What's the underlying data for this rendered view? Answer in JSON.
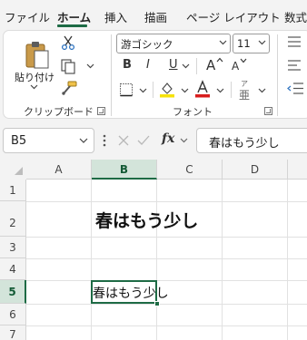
{
  "menu": {
    "tabs": [
      {
        "label": "ファイル"
      },
      {
        "label": "ホーム",
        "active": true
      },
      {
        "label": "挿入"
      },
      {
        "label": "描画"
      },
      {
        "label": "ページ レイアウト"
      },
      {
        "label": "数式"
      }
    ]
  },
  "ribbon": {
    "clipboard": {
      "paste_label": "貼り付け",
      "group_label": "クリップボード"
    },
    "font": {
      "font_name": "游ゴシック",
      "font_size": "11",
      "bold": "B",
      "italic": "I",
      "underline": "U",
      "grow_font": "A",
      "shrink_font": "A",
      "phonetic_top": "ア",
      "phonetic_bottom": "亜",
      "group_label": "フォント"
    }
  },
  "formula_bar": {
    "name_box": "B5",
    "fx_label": "fx",
    "content": "春はもう少し"
  },
  "sheet": {
    "columns": [
      "A",
      "B",
      "C",
      "D"
    ],
    "selected_column": "B",
    "rows": [
      "1",
      "2",
      "3",
      "4",
      "5",
      "6",
      "7"
    ],
    "selected_row": "5",
    "cells": {
      "B2": "春はもう少し",
      "B5": "春はもう少し"
    }
  },
  "colors": {
    "accent": "#1e6b45",
    "selected_header_bg": "#d3e4da"
  }
}
